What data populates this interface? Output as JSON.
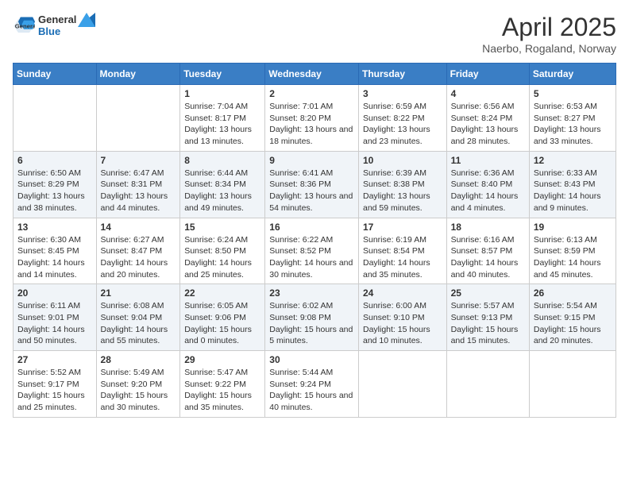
{
  "header": {
    "logo": {
      "general": "General",
      "blue": "Blue"
    },
    "title": "April 2025",
    "subtitle": "Naerbo, Rogaland, Norway"
  },
  "calendar": {
    "weekdays": [
      "Sunday",
      "Monday",
      "Tuesday",
      "Wednesday",
      "Thursday",
      "Friday",
      "Saturday"
    ],
    "weeks": [
      [
        {
          "day": "",
          "sunrise": "",
          "sunset": "",
          "daylight": ""
        },
        {
          "day": "",
          "sunrise": "",
          "sunset": "",
          "daylight": ""
        },
        {
          "day": "1",
          "sunrise": "Sunrise: 7:04 AM",
          "sunset": "Sunset: 8:17 PM",
          "daylight": "Daylight: 13 hours and 13 minutes."
        },
        {
          "day": "2",
          "sunrise": "Sunrise: 7:01 AM",
          "sunset": "Sunset: 8:20 PM",
          "daylight": "Daylight: 13 hours and 18 minutes."
        },
        {
          "day": "3",
          "sunrise": "Sunrise: 6:59 AM",
          "sunset": "Sunset: 8:22 PM",
          "daylight": "Daylight: 13 hours and 23 minutes."
        },
        {
          "day": "4",
          "sunrise": "Sunrise: 6:56 AM",
          "sunset": "Sunset: 8:24 PM",
          "daylight": "Daylight: 13 hours and 28 minutes."
        },
        {
          "day": "5",
          "sunrise": "Sunrise: 6:53 AM",
          "sunset": "Sunset: 8:27 PM",
          "daylight": "Daylight: 13 hours and 33 minutes."
        }
      ],
      [
        {
          "day": "6",
          "sunrise": "Sunrise: 6:50 AM",
          "sunset": "Sunset: 8:29 PM",
          "daylight": "Daylight: 13 hours and 38 minutes."
        },
        {
          "day": "7",
          "sunrise": "Sunrise: 6:47 AM",
          "sunset": "Sunset: 8:31 PM",
          "daylight": "Daylight: 13 hours and 44 minutes."
        },
        {
          "day": "8",
          "sunrise": "Sunrise: 6:44 AM",
          "sunset": "Sunset: 8:34 PM",
          "daylight": "Daylight: 13 hours and 49 minutes."
        },
        {
          "day": "9",
          "sunrise": "Sunrise: 6:41 AM",
          "sunset": "Sunset: 8:36 PM",
          "daylight": "Daylight: 13 hours and 54 minutes."
        },
        {
          "day": "10",
          "sunrise": "Sunrise: 6:39 AM",
          "sunset": "Sunset: 8:38 PM",
          "daylight": "Daylight: 13 hours and 59 minutes."
        },
        {
          "day": "11",
          "sunrise": "Sunrise: 6:36 AM",
          "sunset": "Sunset: 8:40 PM",
          "daylight": "Daylight: 14 hours and 4 minutes."
        },
        {
          "day": "12",
          "sunrise": "Sunrise: 6:33 AM",
          "sunset": "Sunset: 8:43 PM",
          "daylight": "Daylight: 14 hours and 9 minutes."
        }
      ],
      [
        {
          "day": "13",
          "sunrise": "Sunrise: 6:30 AM",
          "sunset": "Sunset: 8:45 PM",
          "daylight": "Daylight: 14 hours and 14 minutes."
        },
        {
          "day": "14",
          "sunrise": "Sunrise: 6:27 AM",
          "sunset": "Sunset: 8:47 PM",
          "daylight": "Daylight: 14 hours and 20 minutes."
        },
        {
          "day": "15",
          "sunrise": "Sunrise: 6:24 AM",
          "sunset": "Sunset: 8:50 PM",
          "daylight": "Daylight: 14 hours and 25 minutes."
        },
        {
          "day": "16",
          "sunrise": "Sunrise: 6:22 AM",
          "sunset": "Sunset: 8:52 PM",
          "daylight": "Daylight: 14 hours and 30 minutes."
        },
        {
          "day": "17",
          "sunrise": "Sunrise: 6:19 AM",
          "sunset": "Sunset: 8:54 PM",
          "daylight": "Daylight: 14 hours and 35 minutes."
        },
        {
          "day": "18",
          "sunrise": "Sunrise: 6:16 AM",
          "sunset": "Sunset: 8:57 PM",
          "daylight": "Daylight: 14 hours and 40 minutes."
        },
        {
          "day": "19",
          "sunrise": "Sunrise: 6:13 AM",
          "sunset": "Sunset: 8:59 PM",
          "daylight": "Daylight: 14 hours and 45 minutes."
        }
      ],
      [
        {
          "day": "20",
          "sunrise": "Sunrise: 6:11 AM",
          "sunset": "Sunset: 9:01 PM",
          "daylight": "Daylight: 14 hours and 50 minutes."
        },
        {
          "day": "21",
          "sunrise": "Sunrise: 6:08 AM",
          "sunset": "Sunset: 9:04 PM",
          "daylight": "Daylight: 14 hours and 55 minutes."
        },
        {
          "day": "22",
          "sunrise": "Sunrise: 6:05 AM",
          "sunset": "Sunset: 9:06 PM",
          "daylight": "Daylight: 15 hours and 0 minutes."
        },
        {
          "day": "23",
          "sunrise": "Sunrise: 6:02 AM",
          "sunset": "Sunset: 9:08 PM",
          "daylight": "Daylight: 15 hours and 5 minutes."
        },
        {
          "day": "24",
          "sunrise": "Sunrise: 6:00 AM",
          "sunset": "Sunset: 9:10 PM",
          "daylight": "Daylight: 15 hours and 10 minutes."
        },
        {
          "day": "25",
          "sunrise": "Sunrise: 5:57 AM",
          "sunset": "Sunset: 9:13 PM",
          "daylight": "Daylight: 15 hours and 15 minutes."
        },
        {
          "day": "26",
          "sunrise": "Sunrise: 5:54 AM",
          "sunset": "Sunset: 9:15 PM",
          "daylight": "Daylight: 15 hours and 20 minutes."
        }
      ],
      [
        {
          "day": "27",
          "sunrise": "Sunrise: 5:52 AM",
          "sunset": "Sunset: 9:17 PM",
          "daylight": "Daylight: 15 hours and 25 minutes."
        },
        {
          "day": "28",
          "sunrise": "Sunrise: 5:49 AM",
          "sunset": "Sunset: 9:20 PM",
          "daylight": "Daylight: 15 hours and 30 minutes."
        },
        {
          "day": "29",
          "sunrise": "Sunrise: 5:47 AM",
          "sunset": "Sunset: 9:22 PM",
          "daylight": "Daylight: 15 hours and 35 minutes."
        },
        {
          "day": "30",
          "sunrise": "Sunrise: 5:44 AM",
          "sunset": "Sunset: 9:24 PM",
          "daylight": "Daylight: 15 hours and 40 minutes."
        },
        {
          "day": "",
          "sunrise": "",
          "sunset": "",
          "daylight": ""
        },
        {
          "day": "",
          "sunrise": "",
          "sunset": "",
          "daylight": ""
        },
        {
          "day": "",
          "sunrise": "",
          "sunset": "",
          "daylight": ""
        }
      ]
    ]
  }
}
